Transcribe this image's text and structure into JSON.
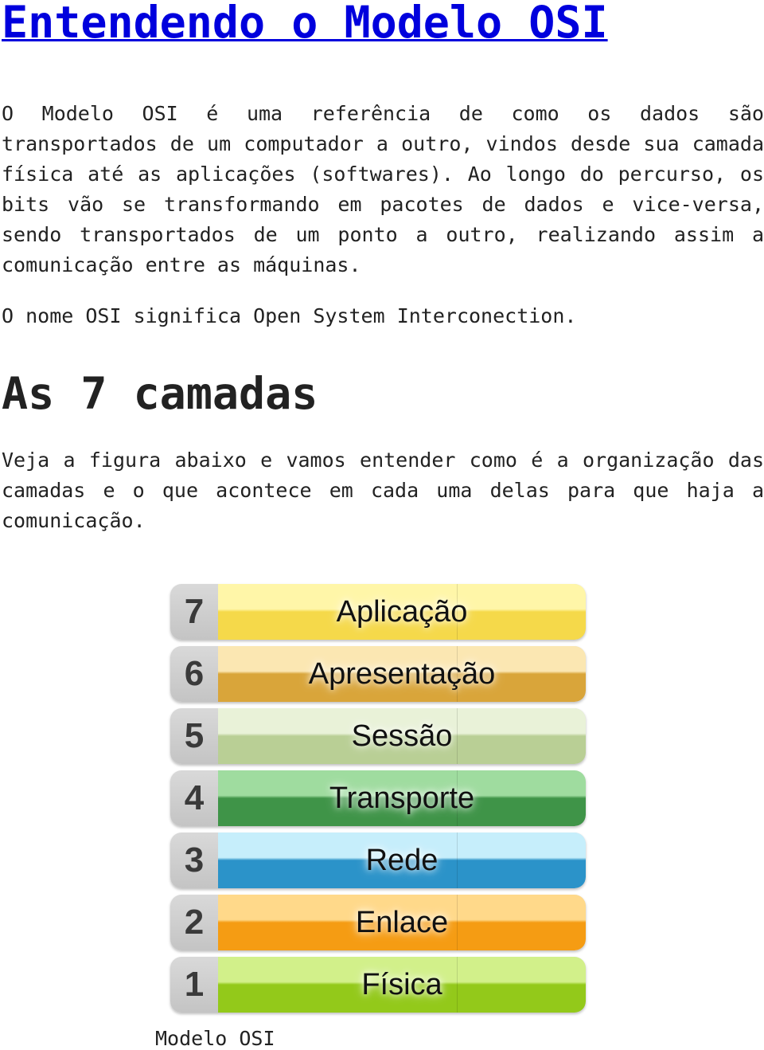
{
  "title": "Entendendo o Modelo OSI",
  "intro": "O Modelo OSI é uma referência de como os dados são transportados de um computador a outro, vindos desde sua camada física até as aplicações (softwares). Ao longo do percurso, os bits vão se transformando em pacotes de dados e vice-versa, sendo transportados de um ponto a outro, realizando assim a comunicação entre as máquinas.",
  "meaning": "O nome OSI significa Open System Interconection.",
  "section_heading": "As 7 camadas",
  "section_text": "Veja a figura abaixo e vamos entender como é a organização das camadas e o que acontece em cada uma delas para que haja a comunicação.",
  "figure": {
    "layers": [
      {
        "number": "7",
        "name": "Aplicação",
        "top": "#fff6a8",
        "bottom": "#f5d94a"
      },
      {
        "number": "6",
        "name": "Apresentação",
        "top": "#fbe7b2",
        "bottom": "#d9a53a"
      },
      {
        "number": "5",
        "name": "Sessão",
        "top": "#e9f2d8",
        "bottom": "#b9cf95"
      },
      {
        "number": "4",
        "name": "Transporte",
        "top": "#9fdc9f",
        "bottom": "#3f9448"
      },
      {
        "number": "3",
        "name": "Rede",
        "top": "#c6eefb",
        "bottom": "#2b93c9"
      },
      {
        "number": "2",
        "name": "Enlace",
        "top": "#ffd98a",
        "bottom": "#f59c13"
      },
      {
        "number": "1",
        "name": "Física",
        "top": "#d2f08a",
        "bottom": "#93c91a"
      }
    ],
    "caption": "Modelo OSI"
  }
}
